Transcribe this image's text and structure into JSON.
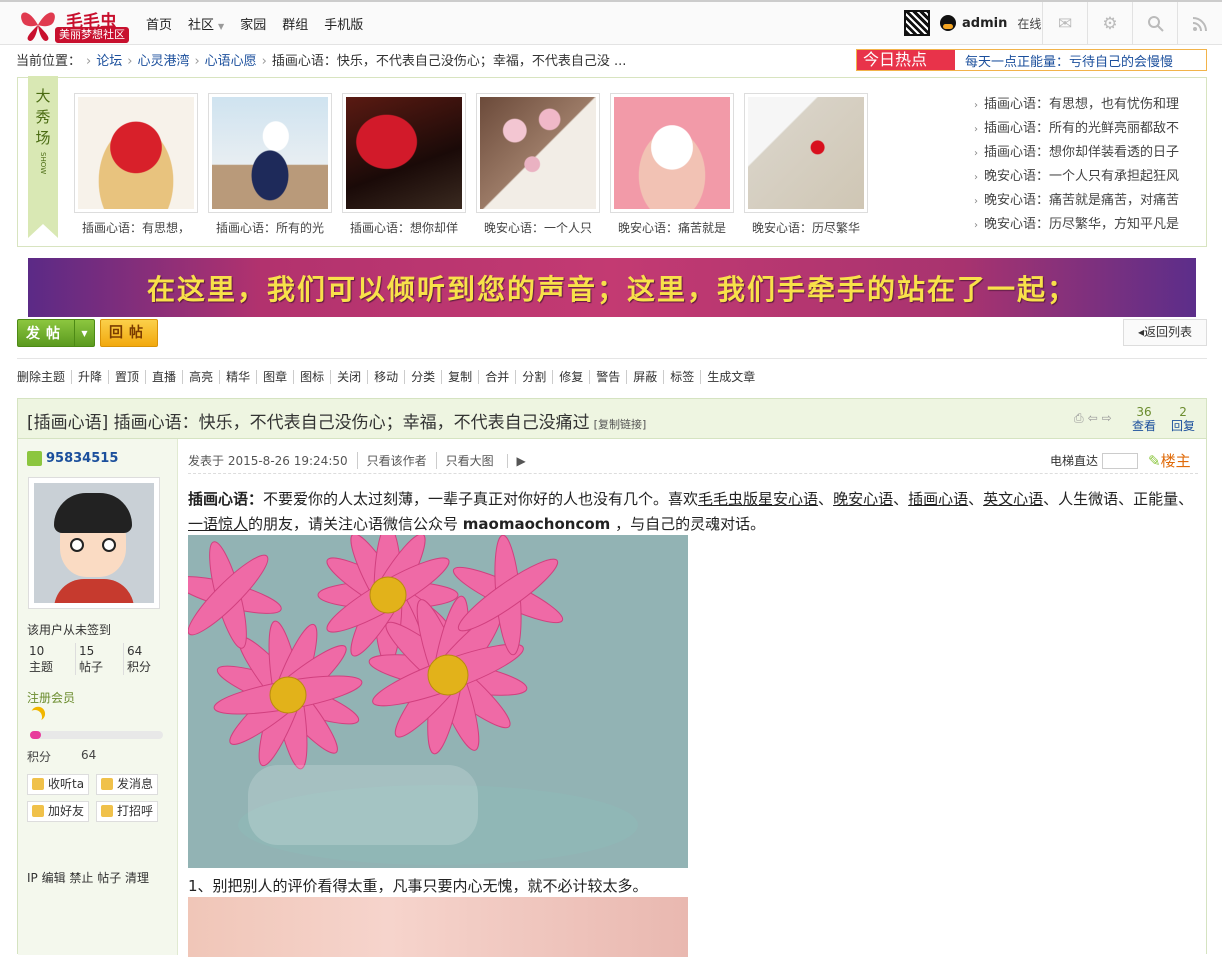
{
  "site": {
    "name": "毛毛虫",
    "tagline": "美丽梦想社区"
  },
  "nav": [
    {
      "label": "首页"
    },
    {
      "label": "社区"
    },
    {
      "label": "家园"
    },
    {
      "label": "群组"
    },
    {
      "label": "手机版"
    }
  ],
  "user": {
    "name": "admin",
    "status": "在线"
  },
  "breadcrumb": {
    "prefix": "当前位置：",
    "items": [
      "论坛",
      "心灵港湾",
      "心语心愿"
    ],
    "current": "插画心语：快乐，不代表自己没伤心；幸福，不代表自己没 ..."
  },
  "hot": {
    "label": "今日热点",
    "text": "每天一点正能量：亏待自己的会慢慢"
  },
  "showcase": {
    "ribbon_title": "大秀场",
    "ribbon_sub": "SHOW",
    "thumbs": [
      {
        "caption": "插画心语：有思想，"
      },
      {
        "caption": "插画心语：所有的光"
      },
      {
        "caption": "插画心语：想你却佯"
      },
      {
        "caption": "晚安心语：一个人只"
      },
      {
        "caption": "晚安心语：痛苦就是"
      },
      {
        "caption": "晚安心语：历尽繁华"
      }
    ],
    "list": [
      "插画心语：有思想，也有忧伤和理",
      "插画心语：所有的光鲜亮丽都敌不",
      "插画心语：想你却佯装看透的日子",
      "晚安心语：一个人只有承担起狂风",
      "晚安心语：痛苦就是痛苦，对痛苦",
      "晚安心语：历尽繁华，方知平凡是"
    ]
  },
  "banner": "在这里，我们可以倾听到您的声音；这里，我们手牵手的站在了一起；",
  "buttons": {
    "post": "发帖",
    "reply": "回帖",
    "back": "返回列表"
  },
  "mod_actions": [
    "删除主题",
    "升降",
    "置顶",
    "直播",
    "高亮",
    "精华",
    "图章",
    "图标",
    "关闭",
    "移动",
    "分类",
    "复制",
    "合并",
    "分割",
    "修复",
    "警告",
    "屏蔽",
    "标签",
    "生成文章"
  ],
  "thread": {
    "title": "[插画心语] 插画心语：快乐，不代表自己没伤心；幸福，不代表自己没痛过",
    "copy_link": "[复制链接]",
    "views": "36",
    "views_label": "查看",
    "replies": "2",
    "replies_label": "回复"
  },
  "author": {
    "name": "95834515",
    "sign_status": "该用户从未签到",
    "stats": [
      {
        "value": "10",
        "label": "主题"
      },
      {
        "value": "15",
        "label": "帖子"
      },
      {
        "value": "64",
        "label": "积分"
      }
    ],
    "group": "注册会员",
    "progress": 0.08,
    "points_label": "积分",
    "points": "64",
    "actions": [
      "收听ta",
      "发消息",
      "加好友",
      "打招呼"
    ],
    "admin_links": "IP 编辑 禁止 帖子 清理"
  },
  "post": {
    "posted": "发表于 2015-8-26 19:24:50",
    "author_only": "只看该作者",
    "big_image": "只看大图",
    "lift_label": "电梯直达",
    "floor": "楼主",
    "intro_bold": "插画心语：",
    "intro_a": "不要爱你的人太过刻薄，一辈子真正对你好的人也没有几个。喜欢",
    "link1": "毛毛虫版星安心语",
    "sep1": "、",
    "link2": "晚安心语",
    "sep2": "、",
    "link3": "插画心语",
    "sep3": "、",
    "link4": "英文心语",
    "intro_b": "、人生微语、正能量、",
    "link5": "一语惊人",
    "intro_c": "的朋友，请关注心语微信公众号 ",
    "wechat": "maomaochoncom",
    "intro_d": " ，与自己的灵魂对话。",
    "line1": "1、别把别人的评价看得太重，凡事只要内心无愧，就不必计较太多。"
  }
}
